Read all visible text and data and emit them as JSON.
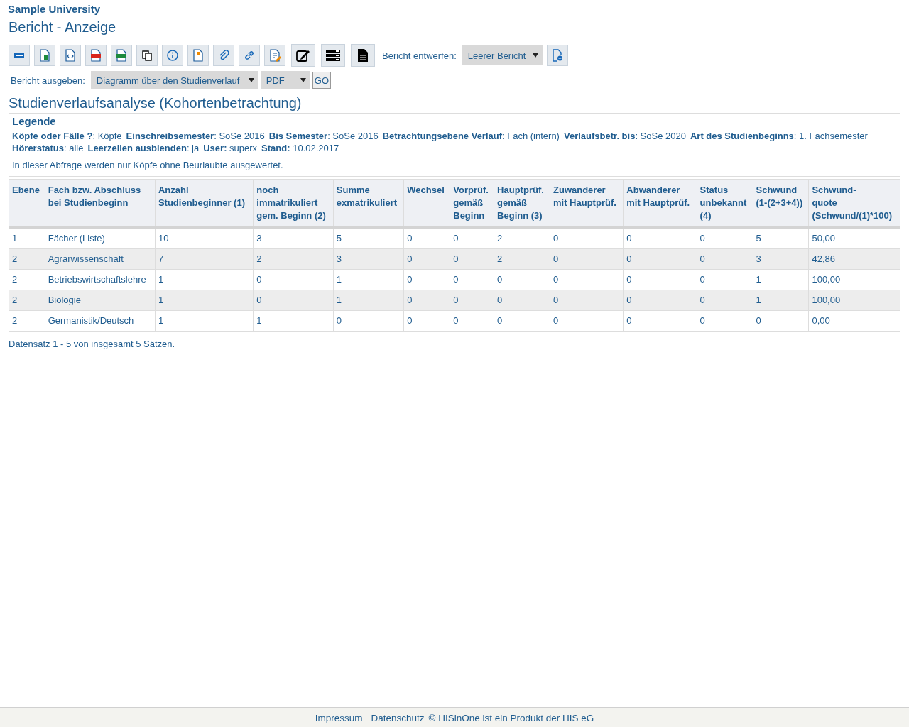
{
  "header": {
    "organization": "Sample University",
    "title": "Bericht - Anzeige"
  },
  "toolbar": {
    "buttons": [
      {
        "kind": "html"
      },
      {
        "kind": "excel"
      },
      {
        "kind": "xml"
      },
      {
        "kind": "pdf"
      },
      {
        "kind": "csv"
      },
      {
        "kind": "copy"
      },
      {
        "kind": "info"
      },
      {
        "kind": "notebook"
      },
      {
        "kind": "attachment"
      },
      {
        "kind": "link"
      },
      {
        "kind": "edit-doc"
      },
      {
        "kind": "edit"
      },
      {
        "kind": "list"
      },
      {
        "kind": "document"
      }
    ],
    "design_label": "Bericht entwerfen:",
    "design_select": "Leerer Bericht",
    "design_button": {
      "kind": "new-doc"
    }
  },
  "output": {
    "label": "Bericht ausgeben:",
    "report_select": "Diagramm über den Studienverlauf",
    "format_select": "PDF",
    "go_button": "GO"
  },
  "report_title": "Studienverlaufsanalyse (Kohortenbetrachtung)",
  "legend": {
    "title": "Legende",
    "items": [
      "**Köpfe oder Fälle ?**: Köpfe",
      "**Einschreibsemester**: SoSe 2016",
      "**Bis Semester**: SoSe 2016",
      "**Betrachtungsebene Verlauf**: Fach (intern)",
      "**Verlaufsbetr. bis**: SoSe 2020",
      "**Art des Studienbeginns**: 1. Fachsemester",
      "**Hörerstatus**: alle",
      "**Leerzeilen ausblenden**: ja",
      "**User:** superx",
      "**Stand:** 10.02.2017"
    ],
    "note": "In dieser Abfrage werden nur Köpfe ohne Beurlaubte ausgewertet."
  },
  "table": {
    "columns": [
      "Ebene",
      "Fach bzw. Abschluss\nbei Studienbeginn",
      "Anzahl\nStudienbeginner (1)",
      "noch\nimmatrikuliert\ngem. Beginn (2)",
      "Summe\nexmatrikuliert",
      "Wechsel",
      "Vorprüf.\ngemäß\nBeginn",
      "Hauptprüf.\ngemäß\nBeginn (3)",
      "Zuwanderer\nmit Hauptprüf.",
      "Abwanderer\nmit Hauptprüf.",
      "Status\nunbekannt\n(4)",
      "Schwund\n(1-(2+3+4))",
      "Schwund-\nquote\n(Schwund/(1)*100)"
    ],
    "rows": [
      [
        "1",
        "Fächer (Liste)",
        "10",
        "3",
        "5",
        "0",
        "0",
        "2",
        "0",
        "0",
        "0",
        "5",
        "50,00"
      ],
      [
        "2",
        "Agrarwissenschaft",
        "7",
        "2",
        "3",
        "0",
        "0",
        "2",
        "0",
        "0",
        "0",
        "3",
        "42,86"
      ],
      [
        "2",
        "Betriebswirtschaftslehre",
        "1",
        "0",
        "1",
        "0",
        "0",
        "0",
        "0",
        "0",
        "0",
        "1",
        "100,00"
      ],
      [
        "2",
        "Biologie",
        "1",
        "0",
        "1",
        "0",
        "0",
        "0",
        "0",
        "0",
        "0",
        "1",
        "100,00"
      ],
      [
        "2",
        "Germanistik/Deutsch",
        "1",
        "1",
        "0",
        "0",
        "0",
        "0",
        "0",
        "0",
        "0",
        "0",
        "0,00"
      ]
    ]
  },
  "record_info": "Datensatz 1 - 5 von insgesamt 5 Sätzen.",
  "footer": {
    "links": [
      "Impressum",
      "Datenschutz"
    ],
    "copyright": "© HISinOne ist ein Produkt der HIS eG"
  }
}
